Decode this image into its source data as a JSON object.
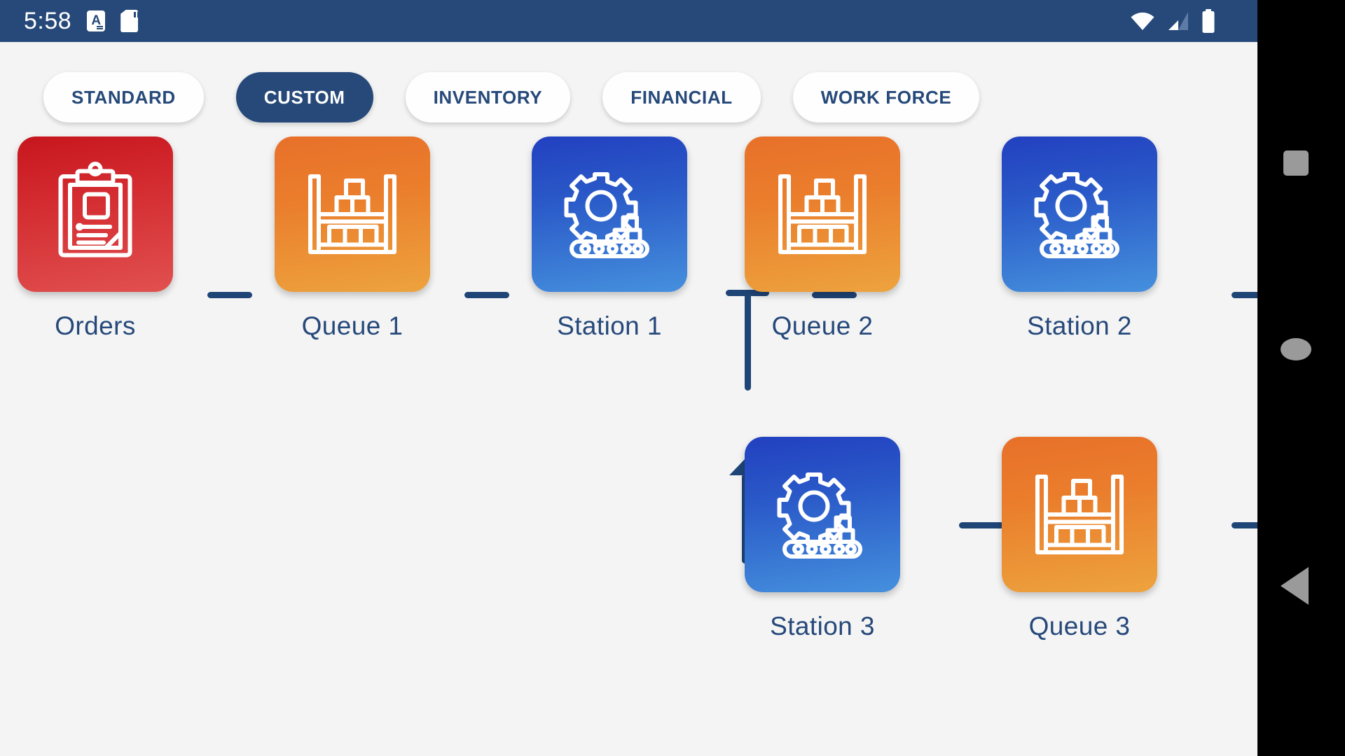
{
  "statusbar": {
    "time": "5:58",
    "icons": [
      "app-notification-icon",
      "sd-card-icon",
      "wifi-icon",
      "cellular-signal-icon",
      "battery-icon"
    ],
    "background": "#26497a"
  },
  "tabs": [
    {
      "label": "STANDARD",
      "active": false
    },
    {
      "label": "CUSTOM",
      "active": true
    },
    {
      "label": "INVENTORY",
      "active": false
    },
    {
      "label": "FINANCIAL",
      "active": false
    },
    {
      "label": "WORK FORCE",
      "active": false
    }
  ],
  "flow": {
    "nodes": [
      {
        "label": "Orders",
        "icon": "clipboard-order-icon",
        "color": "red",
        "row": 1
      },
      {
        "label": "Queue 1",
        "icon": "warehouse-rack-icon",
        "color": "orange",
        "row": 1
      },
      {
        "label": "Station 1",
        "icon": "gear-conveyor-icon",
        "color": "blue",
        "row": 1
      },
      {
        "label": "Queue 2",
        "icon": "warehouse-rack-icon",
        "color": "orange",
        "row": 1
      },
      {
        "label": "Station 2",
        "icon": "gear-conveyor-icon",
        "color": "blue",
        "row": 1
      },
      {
        "label": "Station 3",
        "icon": "gear-conveyor-icon",
        "color": "blue",
        "row": 2
      },
      {
        "label": "Queue 3",
        "icon": "warehouse-rack-icon",
        "color": "orange",
        "row": 2
      }
    ],
    "connector_color": "#1f4577"
  },
  "navbar": {
    "items": [
      "recents-square-icon",
      "home-circle-icon",
      "back-triangle-icon"
    ],
    "background": "#000000"
  },
  "colors": {
    "navy": "#26497a",
    "page_background": "#f4f4f4",
    "red_card": "#c7161d",
    "orange_card": "#e8702a",
    "blue_card": "#2240c0"
  }
}
